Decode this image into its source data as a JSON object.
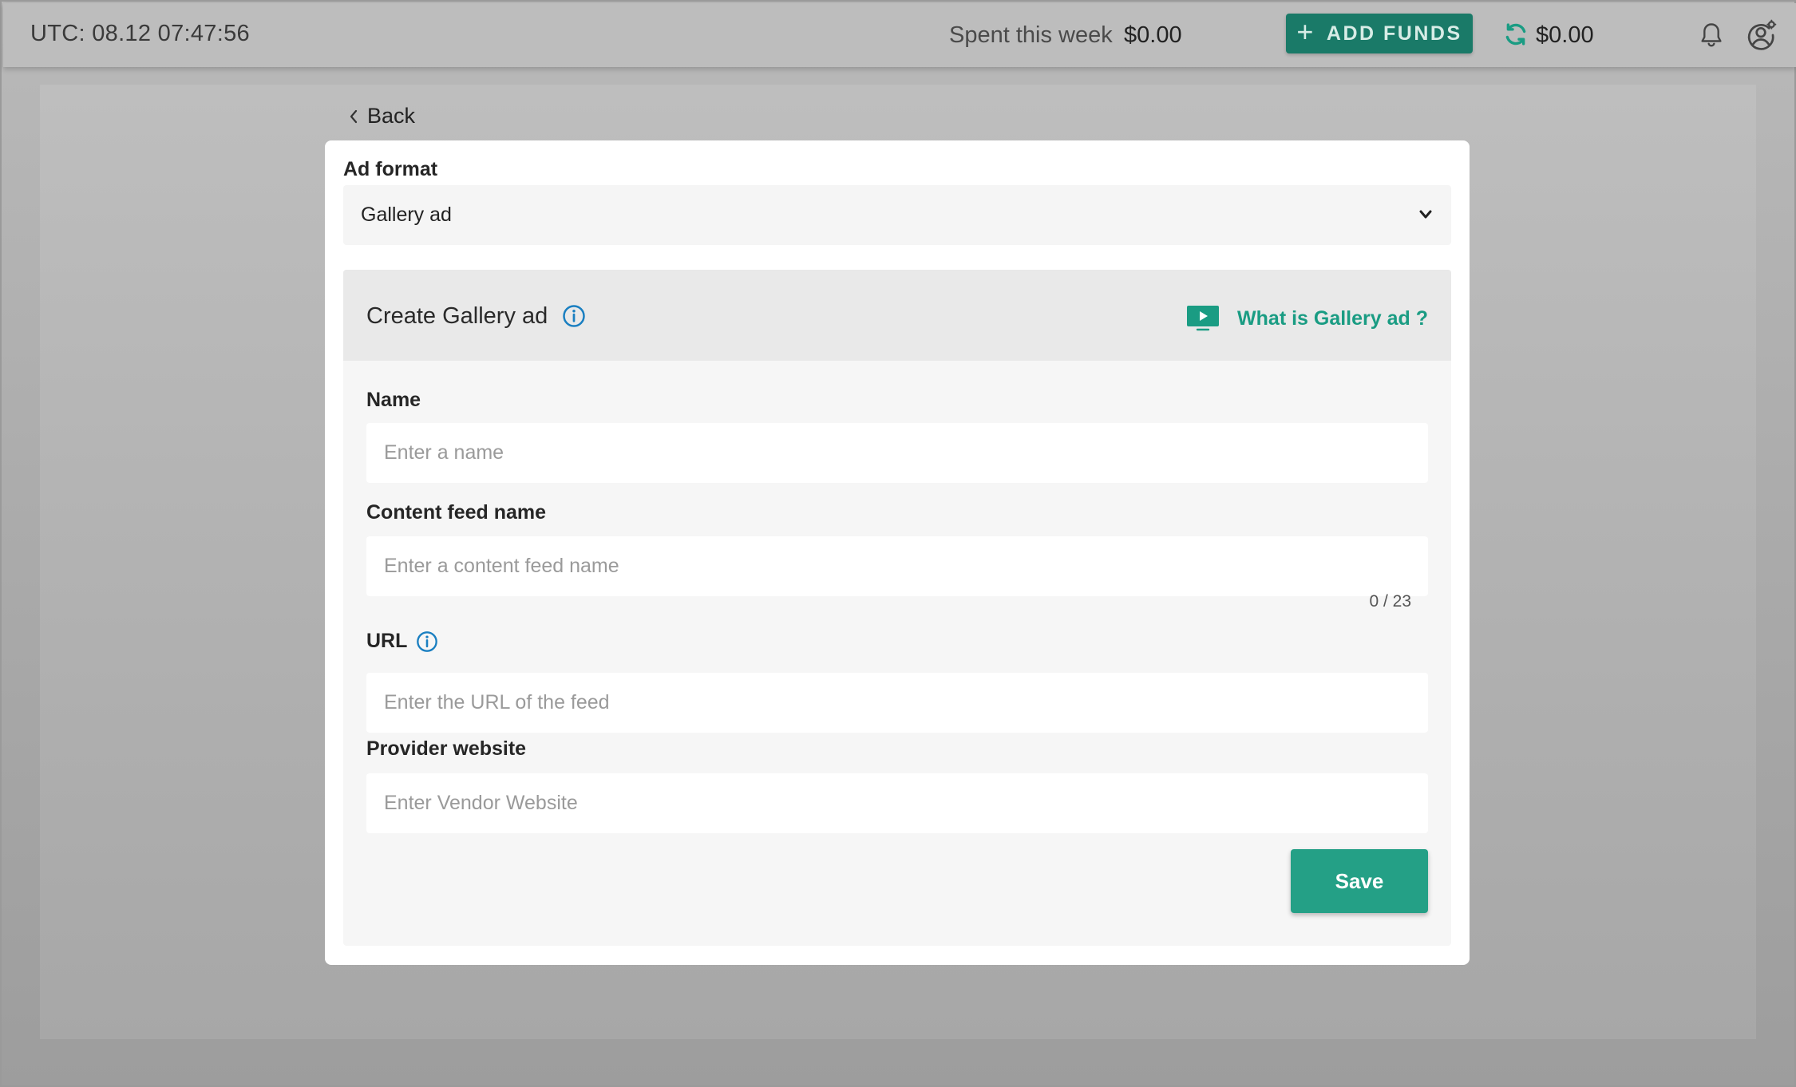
{
  "topbar": {
    "clock": "UTC: 08.12 07:47:56",
    "spent_label": "Spent this week",
    "spent_value": "$0.00",
    "add_funds_label": "ADD FUNDS",
    "balance": "$0.00"
  },
  "back_label": "Back",
  "ad_format": {
    "label": "Ad format",
    "selected": "Gallery ad"
  },
  "section": {
    "title": "Create Gallery ad",
    "help_link": "What is Gallery ad ?"
  },
  "fields": {
    "name": {
      "label": "Name",
      "value": "",
      "placeholder": "Enter a name"
    },
    "content_feed_name": {
      "label": "Content feed name",
      "value": "",
      "placeholder": "Enter a content feed name",
      "counter": "0 / 23"
    },
    "url": {
      "label": "URL",
      "value": "",
      "placeholder": "Enter the URL of the feed"
    },
    "provider_website": {
      "label": "Provider website",
      "value": "",
      "placeholder": "Enter Vendor Website"
    }
  },
  "save_label": "Save",
  "colors": {
    "accent": "#24a086",
    "accent_dark": "#1a7a68",
    "info": "#1a7fc1",
    "link": "#1a9c83"
  },
  "icons": {
    "add_funds": "plus-icon",
    "refresh": "refresh-icon",
    "notifications": "bell-icon",
    "account": "account-settings-icon",
    "back": "chevron-left-icon",
    "select": "chevron-down-icon",
    "info": "info-icon",
    "help": "video-icon"
  }
}
